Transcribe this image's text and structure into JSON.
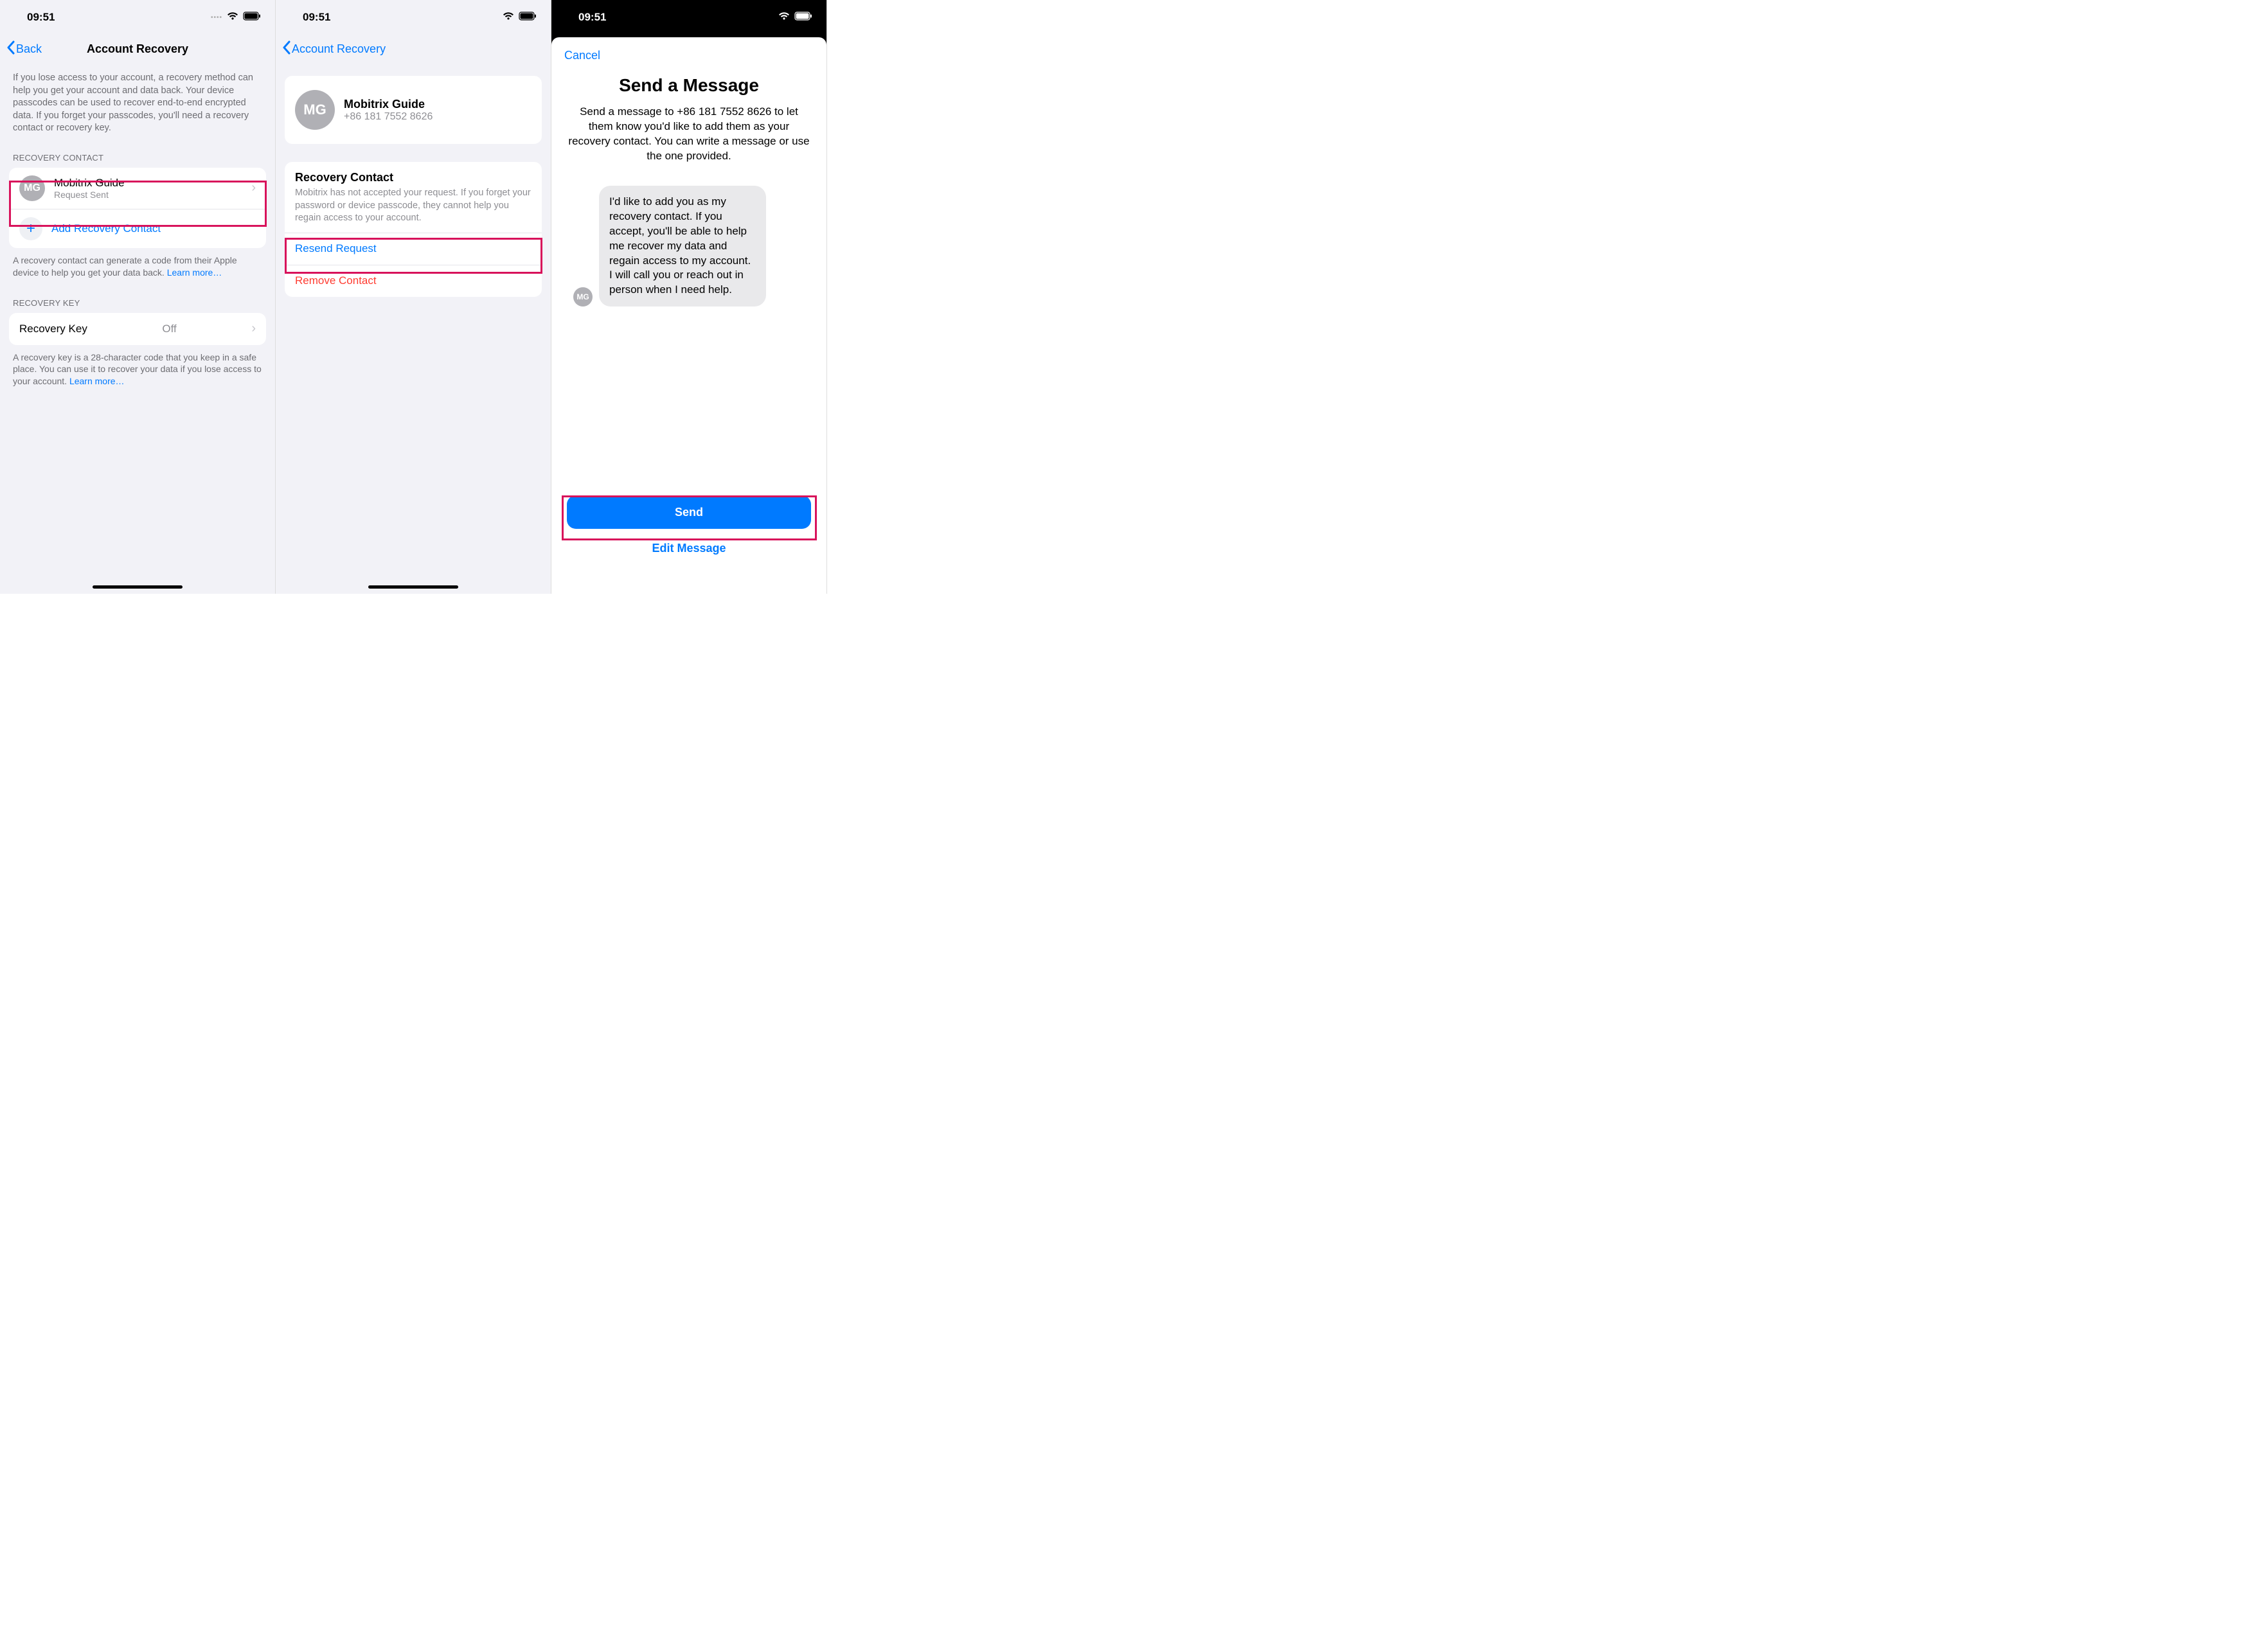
{
  "status": {
    "time": "09:51"
  },
  "screen1": {
    "back": "Back",
    "title": "Account Recovery",
    "intro": "If you lose access to your account, a recovery method can help you get your account and data back. Your device passcodes can be used to recover end-to-end encrypted data. If you forget your passcodes, you'll need a recovery contact or recovery key.",
    "sectionContact": "RECOVERY CONTACT",
    "contact": {
      "initials": "MG",
      "name": "Mobitrix Guide",
      "status": "Request Sent"
    },
    "addContact": "Add Recovery Contact",
    "contactFooter": "A recovery contact can generate a code from their Apple device to help you get your data back. ",
    "learnMore": "Learn more…",
    "sectionKey": "RECOVERY KEY",
    "recoveryKey": {
      "label": "Recovery Key",
      "value": "Off"
    },
    "keyFooter": "A recovery key is a 28-character code that you keep in a safe place. You can use it to recover your data if you lose access to your account. "
  },
  "screen2": {
    "back": "Account Recovery",
    "contact": {
      "initials": "MG",
      "name": "Mobitrix Guide",
      "phone": "+86 181 7552 8626"
    },
    "recoveryHeader": "Recovery Contact",
    "recoveryDesc": "Mobitrix has not accepted your request. If you forget your password or device passcode, they cannot help you regain access to your account.",
    "resend": "Resend Request",
    "remove": "Remove Contact"
  },
  "screen3": {
    "cancel": "Cancel",
    "title": "Send a Message",
    "body": "Send a message to +86 181 7552 8626 to let them know you'd like to add them as your recovery contact. You can write a message or use the one provided.",
    "avatarInitials": "MG",
    "bubble": "I'd like to add you as my recovery contact. If you accept, you'll be able to help me recover my data and regain access to my account. I will call you or reach out in person when I need help.",
    "send": "Send",
    "edit": "Edit Message"
  }
}
